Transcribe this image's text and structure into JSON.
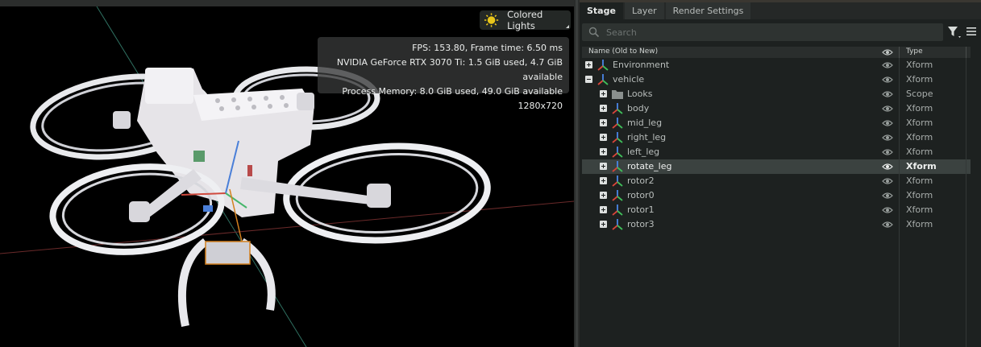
{
  "viewport": {
    "lights_label": "Colored Lights",
    "stats": [
      "FPS: 153.80, Frame time: 6.50 ms",
      "NVIDIA GeForce RTX 3070 Ti: 1.5 GiB used, 4.7 GiB available",
      "Process Memory: 8.0 GiB used, 49.0 GiB available",
      "1280x720"
    ]
  },
  "stage": {
    "tabs": [
      {
        "label": "Stage",
        "active": true
      },
      {
        "label": "Layer",
        "active": false
      },
      {
        "label": "Render Settings",
        "active": false
      }
    ],
    "search_placeholder": "Search",
    "columns": {
      "name": "Name (Old to New)",
      "type": "Type"
    },
    "rows": [
      {
        "name": "Environment",
        "type": "Xform",
        "expander": "plus",
        "indent": 0,
        "icon": "xform-icon",
        "selected": false
      },
      {
        "name": "vehicle",
        "type": "Xform",
        "expander": "minus",
        "indent": 0,
        "icon": "xform-icon",
        "selected": false
      },
      {
        "name": "Looks",
        "type": "Scope",
        "expander": "plus",
        "indent": 1,
        "icon": "folder-icon",
        "selected": false
      },
      {
        "name": "body",
        "type": "Xform",
        "expander": "plus",
        "indent": 1,
        "icon": "xform-icon",
        "selected": false
      },
      {
        "name": "mid_leg",
        "type": "Xform",
        "expander": "plus",
        "indent": 1,
        "icon": "xform-icon",
        "selected": false
      },
      {
        "name": "right_leg",
        "type": "Xform",
        "expander": "plus",
        "indent": 1,
        "icon": "xform-icon",
        "selected": false
      },
      {
        "name": "left_leg",
        "type": "Xform",
        "expander": "plus",
        "indent": 1,
        "icon": "xform-icon",
        "selected": false
      },
      {
        "name": "rotate_leg",
        "type": "Xform",
        "expander": "plus",
        "indent": 1,
        "icon": "xform-icon",
        "selected": true
      },
      {
        "name": "rotor2",
        "type": "Xform",
        "expander": "plus",
        "indent": 1,
        "icon": "xform-icon",
        "selected": false
      },
      {
        "name": "rotor0",
        "type": "Xform",
        "expander": "plus",
        "indent": 1,
        "icon": "xform-icon",
        "selected": false
      },
      {
        "name": "rotor1",
        "type": "Xform",
        "expander": "plus",
        "indent": 1,
        "icon": "xform-icon",
        "selected": false
      },
      {
        "name": "rotor3",
        "type": "Xform",
        "expander": "plus",
        "indent": 1,
        "icon": "xform-icon",
        "selected": false
      }
    ]
  },
  "colors": {
    "selection": "#3b4240",
    "xform_red": "#d9453a",
    "xform_green": "#3fbf5a",
    "xform_blue": "#4a86e8",
    "sun_yellow": "#e8c51a"
  }
}
